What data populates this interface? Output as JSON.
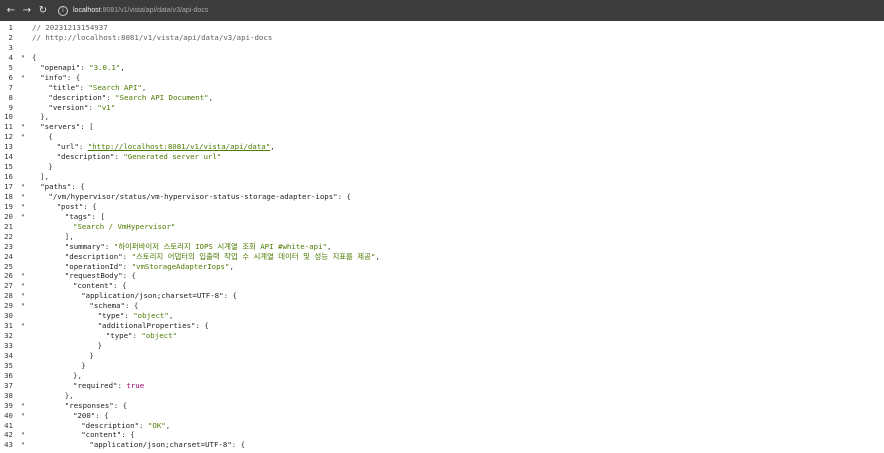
{
  "browser": {
    "url_host": "localhost",
    "url_path": ":8081/v1/vista/api/data/v3/api-docs"
  },
  "code_lines": [
    {
      "n": "1",
      "fold": false,
      "indent": 0,
      "t": [
        {
          "c": "c",
          "v": "// 20231213154937"
        }
      ]
    },
    {
      "n": "2",
      "fold": false,
      "indent": 0,
      "t": [
        {
          "c": "c",
          "v": "// http://localhost:8081/v1/vista/api/data/v3/api-docs"
        }
      ]
    },
    {
      "n": "3",
      "fold": false,
      "indent": 0,
      "t": []
    },
    {
      "n": "4",
      "fold": true,
      "indent": 0,
      "t": [
        {
          "c": "p",
          "v": "{"
        }
      ]
    },
    {
      "n": "5",
      "fold": false,
      "indent": 1,
      "t": [
        {
          "c": "k",
          "v": "\"openapi\""
        },
        {
          "c": "p",
          "v": ": "
        },
        {
          "c": "s",
          "v": "\"3.0.1\""
        },
        {
          "c": "p",
          "v": ","
        }
      ]
    },
    {
      "n": "6",
      "fold": true,
      "indent": 1,
      "t": [
        {
          "c": "k",
          "v": "\"info\""
        },
        {
          "c": "p",
          "v": ": {"
        }
      ]
    },
    {
      "n": "7",
      "fold": false,
      "indent": 2,
      "t": [
        {
          "c": "k",
          "v": "\"title\""
        },
        {
          "c": "p",
          "v": ": "
        },
        {
          "c": "s",
          "v": "\"Search API\""
        },
        {
          "c": "p",
          "v": ","
        }
      ]
    },
    {
      "n": "8",
      "fold": false,
      "indent": 2,
      "t": [
        {
          "c": "k",
          "v": "\"description\""
        },
        {
          "c": "p",
          "v": ": "
        },
        {
          "c": "s",
          "v": "\"Search API Document\""
        },
        {
          "c": "p",
          "v": ","
        }
      ]
    },
    {
      "n": "9",
      "fold": false,
      "indent": 2,
      "t": [
        {
          "c": "k",
          "v": "\"version\""
        },
        {
          "c": "p",
          "v": ": "
        },
        {
          "c": "s",
          "v": "\"v1\""
        }
      ]
    },
    {
      "n": "10",
      "fold": false,
      "indent": 1,
      "t": [
        {
          "c": "p",
          "v": "},"
        }
      ]
    },
    {
      "n": "11",
      "fold": true,
      "indent": 1,
      "t": [
        {
          "c": "k",
          "v": "\"servers\""
        },
        {
          "c": "p",
          "v": ": ["
        }
      ]
    },
    {
      "n": "12",
      "fold": true,
      "indent": 2,
      "t": [
        {
          "c": "p",
          "v": "{"
        }
      ]
    },
    {
      "n": "13",
      "fold": false,
      "indent": 3,
      "t": [
        {
          "c": "k",
          "v": "\"url\""
        },
        {
          "c": "p",
          "v": ": "
        },
        {
          "c": "u",
          "v": "\"http://localhost:8081/v1/vista/api/data\""
        },
        {
          "c": "p",
          "v": ","
        }
      ]
    },
    {
      "n": "14",
      "fold": false,
      "indent": 3,
      "t": [
        {
          "c": "k",
          "v": "\"description\""
        },
        {
          "c": "p",
          "v": ": "
        },
        {
          "c": "s",
          "v": "\"Generated server url\""
        }
      ]
    },
    {
      "n": "15",
      "fold": false,
      "indent": 2,
      "t": [
        {
          "c": "p",
          "v": "}"
        }
      ]
    },
    {
      "n": "16",
      "fold": false,
      "indent": 1,
      "t": [
        {
          "c": "p",
          "v": "],"
        }
      ]
    },
    {
      "n": "17",
      "fold": true,
      "indent": 1,
      "t": [
        {
          "c": "k",
          "v": "\"paths\""
        },
        {
          "c": "p",
          "v": ": {"
        }
      ]
    },
    {
      "n": "18",
      "fold": true,
      "indent": 2,
      "t": [
        {
          "c": "k",
          "v": "\"/vm/hypervisor/status/vm-hypervisor-status-storage-adapter-iops\""
        },
        {
          "c": "p",
          "v": ": {"
        }
      ]
    },
    {
      "n": "19",
      "fold": true,
      "indent": 3,
      "t": [
        {
          "c": "k",
          "v": "\"post\""
        },
        {
          "c": "p",
          "v": ": {"
        }
      ]
    },
    {
      "n": "20",
      "fold": true,
      "indent": 4,
      "t": [
        {
          "c": "k",
          "v": "\"tags\""
        },
        {
          "c": "p",
          "v": ": ["
        }
      ]
    },
    {
      "n": "21",
      "fold": false,
      "indent": 5,
      "t": [
        {
          "c": "s",
          "v": "\"Search / VmHypervisor\""
        }
      ]
    },
    {
      "n": "22",
      "fold": false,
      "indent": 4,
      "t": [
        {
          "c": "p",
          "v": "],"
        }
      ]
    },
    {
      "n": "23",
      "fold": false,
      "indent": 4,
      "t": [
        {
          "c": "k",
          "v": "\"summary\""
        },
        {
          "c": "p",
          "v": ": "
        },
        {
          "c": "s",
          "v": "\"하이퍼바이저 스토리지 IOPS 시계열 조회 API #white-api\""
        },
        {
          "c": "p",
          "v": ","
        }
      ]
    },
    {
      "n": "24",
      "fold": false,
      "indent": 4,
      "t": [
        {
          "c": "k",
          "v": "\"description\""
        },
        {
          "c": "p",
          "v": ": "
        },
        {
          "c": "s",
          "v": "\"스토리지 어댑터의 입출력 작업 수 시계열 데이터 및 성능 지표를 제공\""
        },
        {
          "c": "p",
          "v": ","
        }
      ]
    },
    {
      "n": "25",
      "fold": false,
      "indent": 4,
      "t": [
        {
          "c": "k",
          "v": "\"operationId\""
        },
        {
          "c": "p",
          "v": ": "
        },
        {
          "c": "s",
          "v": "\"vmStorageAdapterIops\""
        },
        {
          "c": "p",
          "v": ","
        }
      ]
    },
    {
      "n": "26",
      "fold": true,
      "indent": 4,
      "t": [
        {
          "c": "k",
          "v": "\"requestBody\""
        },
        {
          "c": "p",
          "v": ": {"
        }
      ]
    },
    {
      "n": "27",
      "fold": true,
      "indent": 5,
      "t": [
        {
          "c": "k",
          "v": "\"content\""
        },
        {
          "c": "p",
          "v": ": {"
        }
      ]
    },
    {
      "n": "28",
      "fold": true,
      "indent": 6,
      "t": [
        {
          "c": "k",
          "v": "\"application/json;charset=UTF-8\""
        },
        {
          "c": "p",
          "v": ": {"
        }
      ]
    },
    {
      "n": "29",
      "fold": true,
      "indent": 7,
      "t": [
        {
          "c": "k",
          "v": "\"schema\""
        },
        {
          "c": "p",
          "v": ": {"
        }
      ]
    },
    {
      "n": "30",
      "fold": false,
      "indent": 8,
      "t": [
        {
          "c": "k",
          "v": "\"type\""
        },
        {
          "c": "p",
          "v": ": "
        },
        {
          "c": "s",
          "v": "\"object\""
        },
        {
          "c": "p",
          "v": ","
        }
      ]
    },
    {
      "n": "31",
      "fold": true,
      "indent": 8,
      "t": [
        {
          "c": "k",
          "v": "\"additionalProperties\""
        },
        {
          "c": "p",
          "v": ": {"
        }
      ]
    },
    {
      "n": "32",
      "fold": false,
      "indent": 9,
      "t": [
        {
          "c": "k",
          "v": "\"type\""
        },
        {
          "c": "p",
          "v": ": "
        },
        {
          "c": "s",
          "v": "\"object\""
        }
      ]
    },
    {
      "n": "33",
      "fold": false,
      "indent": 8,
      "t": [
        {
          "c": "p",
          "v": "}"
        }
      ]
    },
    {
      "n": "34",
      "fold": false,
      "indent": 7,
      "t": [
        {
          "c": "p",
          "v": "}"
        }
      ]
    },
    {
      "n": "35",
      "fold": false,
      "indent": 6,
      "t": [
        {
          "c": "p",
          "v": "}"
        }
      ]
    },
    {
      "n": "36",
      "fold": false,
      "indent": 5,
      "t": [
        {
          "c": "p",
          "v": "},"
        }
      ]
    },
    {
      "n": "37",
      "fold": false,
      "indent": 5,
      "t": [
        {
          "c": "k",
          "v": "\"required\""
        },
        {
          "c": "p",
          "v": ": "
        },
        {
          "c": "b",
          "v": "true"
        }
      ]
    },
    {
      "n": "38",
      "fold": false,
      "indent": 4,
      "t": [
        {
          "c": "p",
          "v": "},"
        }
      ]
    },
    {
      "n": "39",
      "fold": true,
      "indent": 4,
      "t": [
        {
          "c": "k",
          "v": "\"responses\""
        },
        {
          "c": "p",
          "v": ": {"
        }
      ]
    },
    {
      "n": "40",
      "fold": true,
      "indent": 5,
      "t": [
        {
          "c": "k",
          "v": "\"200\""
        },
        {
          "c": "p",
          "v": ": {"
        }
      ]
    },
    {
      "n": "41",
      "fold": false,
      "indent": 6,
      "t": [
        {
          "c": "k",
          "v": "\"description\""
        },
        {
          "c": "p",
          "v": ": "
        },
        {
          "c": "s",
          "v": "\"OK\""
        },
        {
          "c": "p",
          "v": ","
        }
      ]
    },
    {
      "n": "42",
      "fold": true,
      "indent": 6,
      "t": [
        {
          "c": "k",
          "v": "\"content\""
        },
        {
          "c": "p",
          "v": ": {"
        }
      ]
    },
    {
      "n": "43",
      "fold": true,
      "indent": 7,
      "t": [
        {
          "c": "k",
          "v": "\"application/json;charset=UTF-8\""
        },
        {
          "c": "p",
          "v": ": {"
        }
      ]
    }
  ]
}
